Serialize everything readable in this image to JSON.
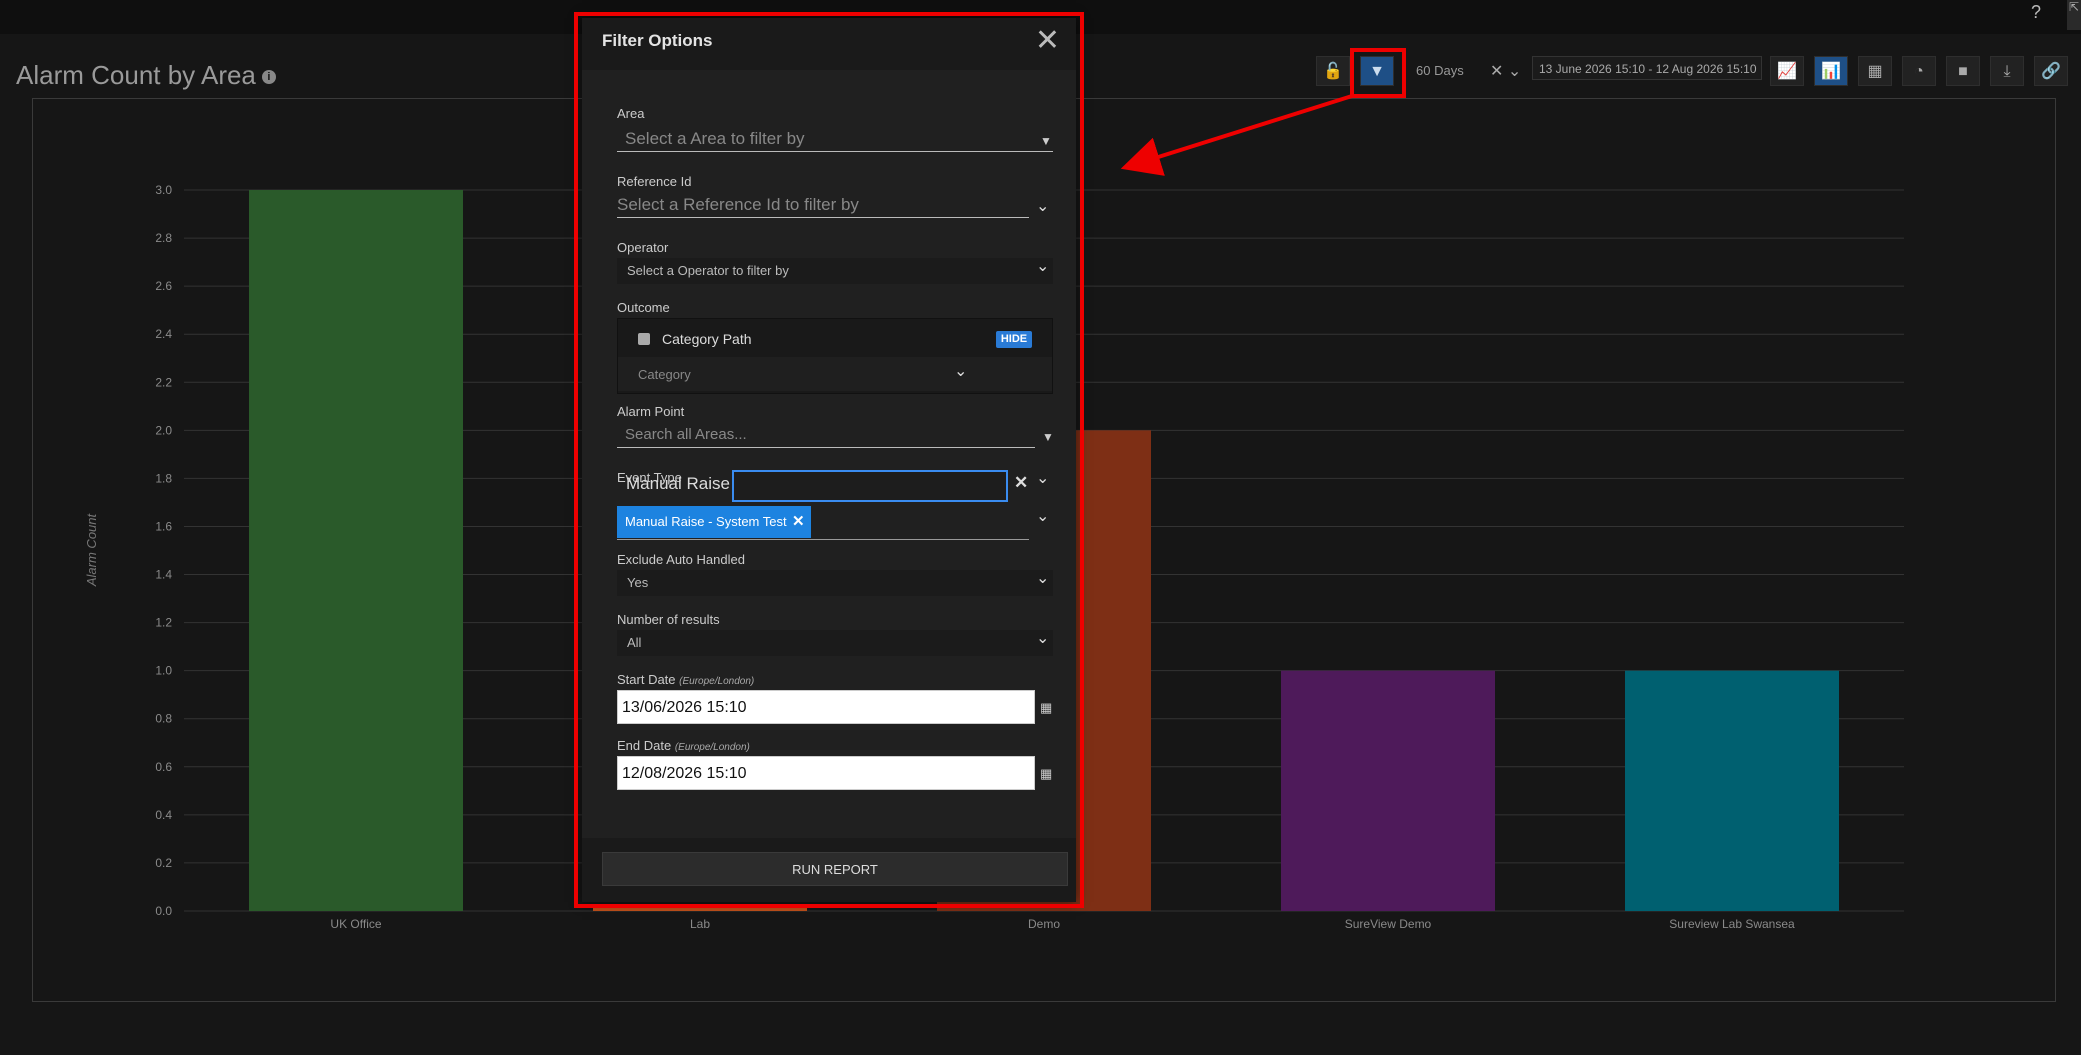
{
  "page": {
    "title": "Alarm Count by Area",
    "help_glyph": "?",
    "corner_glyph": "⇱"
  },
  "toolbar": {
    "days_label": "60 Days",
    "clear_glyph": "✕ ⌄",
    "date_range": "13 June 2026 15:10 - 12 Aug 2026 15:10",
    "buttons": [
      {
        "name": "lock-icon",
        "glyph": "🔓"
      },
      {
        "name": "filter-icon",
        "glyph": "▼"
      },
      {
        "name": "line-chart-icon",
        "glyph": "📈"
      },
      {
        "name": "bar-chart-icon",
        "glyph": "📊"
      },
      {
        "name": "table-icon",
        "glyph": "▦"
      },
      {
        "name": "pie-chart-icon",
        "glyph": "◔"
      },
      {
        "name": "stop-icon",
        "glyph": "■"
      },
      {
        "name": "download-icon",
        "glyph": "⤓"
      },
      {
        "name": "link-icon",
        "glyph": "🔗"
      }
    ]
  },
  "filter": {
    "title": "Filter Options",
    "close_glyph": "✕",
    "area_label": "Area",
    "area_placeholder": "Select a Area to filter by",
    "reference_label": "Reference Id",
    "reference_placeholder": "Select a Reference Id to filter by",
    "operator_label": "Operator",
    "operator_placeholder": "Select a Operator to filter by",
    "outcome_label": "Outcome",
    "category_path_label": "Category Path",
    "hide_label": "HIDE",
    "category_placeholder": "Category",
    "alarm_point_label": "Alarm Point",
    "alarm_point_placeholder": "Search all Areas...",
    "event_type_label": "Event Type",
    "event_type_text": "Manual Raise",
    "event_type_chip": "Manual Raise - System Test",
    "exclude_label": "Exclude Auto Handled",
    "exclude_value": "Yes",
    "results_label": "Number of results",
    "results_value": "All",
    "start_label": "Start Date",
    "start_tz": "(Europe/London)",
    "start_value": "13/06/2026 15:10",
    "end_label": "End Date",
    "end_tz": "(Europe/London)",
    "end_value": "12/08/2026 15:10",
    "run_label": "RUN REPORT"
  },
  "chart_data": {
    "type": "bar",
    "title": "",
    "xlabel": "",
    "ylabel": "Alarm Count",
    "categories": [
      "UK Office",
      "Lab",
      "Demo",
      "SureView Demo",
      "Sureview Lab Swansea"
    ],
    "values": [
      3,
      0.02,
      2,
      1,
      1
    ],
    "colors": [
      "#2a5a2a",
      "#c0501b",
      "#7e2f15",
      "#4e1a5a",
      "#006070"
    ],
    "ylim": [
      0,
      3
    ],
    "yticks": [
      "0.0",
      "0.2",
      "0.4",
      "0.6",
      "0.8",
      "1.0",
      "1.2",
      "1.4",
      "1.6",
      "1.8",
      "2.0",
      "2.2",
      "2.4",
      "2.6",
      "2.8",
      "3.0"
    ],
    "grid": true,
    "legend": "none"
  }
}
